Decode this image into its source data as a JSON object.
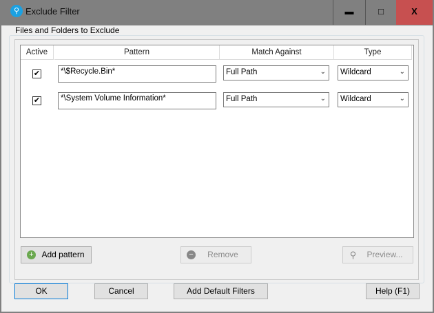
{
  "window": {
    "title": "Exclude Filter",
    "minimize": "▬",
    "maximize": "□",
    "close": "X"
  },
  "group_label": "Files and Folders to Exclude",
  "columns": [
    "Active",
    "Pattern",
    "Match Against",
    "Type"
  ],
  "rows": [
    {
      "active": true,
      "pattern": "*\\$Recycle.Bin*",
      "match": "Full Path",
      "type": "Wildcard"
    },
    {
      "active": true,
      "pattern": "*\\System Volume Information*",
      "match": "Full Path",
      "type": "Wildcard"
    }
  ],
  "buttons": {
    "add": "Add pattern",
    "remove": "Remove",
    "preview": "Preview...",
    "ok": "OK",
    "cancel": "Cancel",
    "defaults": "Add Default Filters",
    "help": "Help (F1)"
  },
  "check": "✔",
  "arrow": "⌄"
}
